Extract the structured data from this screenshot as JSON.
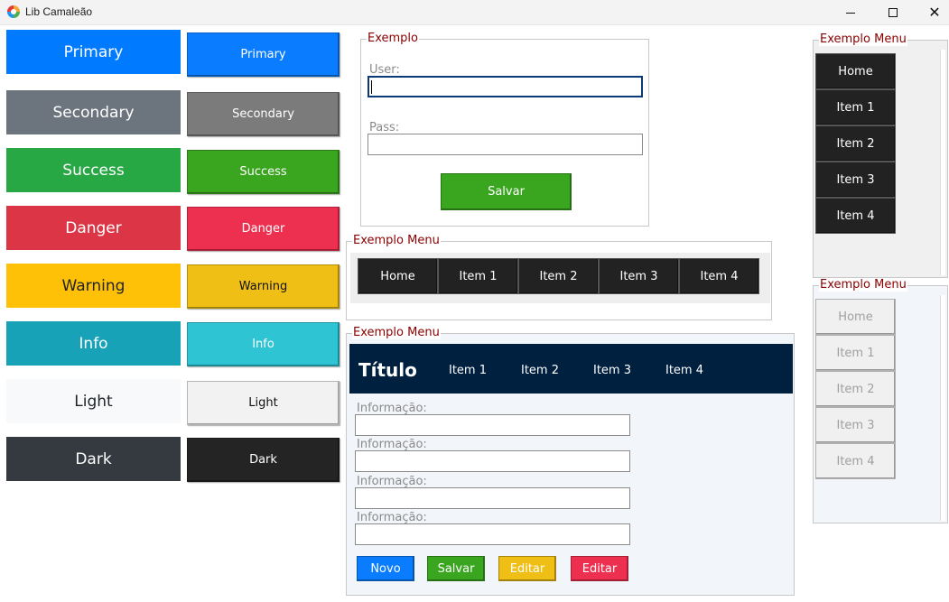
{
  "window": {
    "title": "Lib Camaleão"
  },
  "flat_buttons": [
    {
      "label": "Primary",
      "bg": "#007bff",
      "fg": "#ffffff"
    },
    {
      "label": "Secondary",
      "bg": "#6c757d",
      "fg": "#ffffff"
    },
    {
      "label": "Success",
      "bg": "#28a745",
      "fg": "#ffffff"
    },
    {
      "label": "Danger",
      "bg": "#dc3545",
      "fg": "#ffffff"
    },
    {
      "label": "Warning",
      "bg": "#ffc107",
      "fg": "#212529"
    },
    {
      "label": "Info",
      "bg": "#17a2b8",
      "fg": "#ffffff"
    },
    {
      "label": "Light",
      "bg": "#f8f9fa",
      "fg": "#212529"
    },
    {
      "label": "Dark",
      "bg": "#343a40",
      "fg": "#ffffff"
    }
  ],
  "bevel_buttons": [
    {
      "label": "Primary",
      "bg": "#0a7cff",
      "fg": "#ffffff"
    },
    {
      "label": "Secondary",
      "bg": "#7b7b7b",
      "fg": "#ffffff"
    },
    {
      "label": "Success",
      "bg": "#3aa61f",
      "fg": "#ffffff"
    },
    {
      "label": "Danger",
      "bg": "#ee3050",
      "fg": "#ffffff"
    },
    {
      "label": "Warning",
      "bg": "#efbf16",
      "fg": "#111111"
    },
    {
      "label": "Info",
      "bg": "#2fc4d3",
      "fg": "#ffffff"
    },
    {
      "label": "Light",
      "bg": "#f2f2f2",
      "fg": "#111111"
    },
    {
      "label": "Dark",
      "bg": "#242424",
      "fg": "#ffffff"
    }
  ],
  "login": {
    "legend": "Exemplo",
    "user_label": "User:",
    "user_value": "",
    "pass_label": "Pass:",
    "pass_value": "",
    "save_label": "Salvar"
  },
  "hmenu": {
    "legend": "Exemplo Menu",
    "items": [
      "Home",
      "Item 1",
      "Item 2",
      "Item 3",
      "Item 4"
    ]
  },
  "form": {
    "legend": "Exemplo Menu",
    "title": "Título",
    "nav": [
      "Item 1",
      "Item 2",
      "Item 3",
      "Item 4"
    ],
    "fields": [
      {
        "label": "Informação:",
        "value": ""
      },
      {
        "label": "Informação:",
        "value": ""
      },
      {
        "label": "Informação:",
        "value": ""
      },
      {
        "label": "Informação:",
        "value": ""
      }
    ],
    "buttons": [
      {
        "label": "Novo",
        "bg": "#0a7cff",
        "fg": "#ffffff"
      },
      {
        "label": "Salvar",
        "bg": "#3aa61f",
        "fg": "#ffffff"
      },
      {
        "label": "Editar",
        "bg": "#efbf16",
        "fg": "#ffffff"
      },
      {
        "label": "Editar",
        "bg": "#ee3050",
        "fg": "#ffffff"
      }
    ],
    "header_bg": "#00203f"
  },
  "vmenu_dark": {
    "legend": "Exemplo Menu",
    "items": [
      "Home",
      "Item 1",
      "Item 2",
      "Item 3",
      "Item 4"
    ]
  },
  "vmenu_light": {
    "legend": "Exemplo Menu",
    "items": [
      "Home",
      "Item 1",
      "Item 2",
      "Item 3",
      "Item 4"
    ]
  }
}
